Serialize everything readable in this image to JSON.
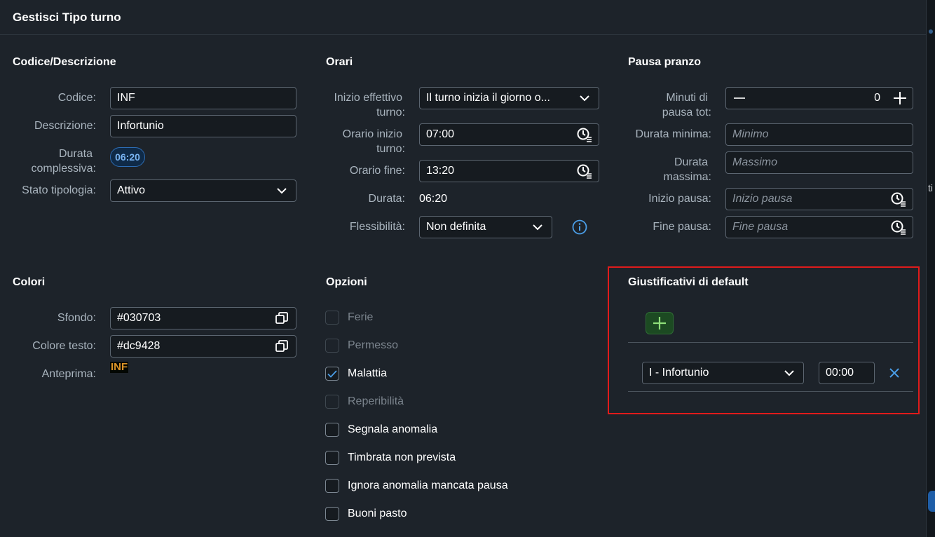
{
  "dialog": {
    "title": "Gestisci Tipo turno"
  },
  "sections": {
    "codice": {
      "title": "Codice/Descrizione",
      "codice_label": "Codice:",
      "codice_value": "INF",
      "descrizione_label": "Descrizione:",
      "descrizione_value": "Infortunio",
      "durata_label_1": "Durata",
      "durata_label_2": "complessiva:",
      "durata_value": "06:20",
      "stato_label": "Stato tipologia:",
      "stato_value": "Attivo"
    },
    "orari": {
      "title": "Orari",
      "inizio_effettivo_label_1": "Inizio effettivo",
      "inizio_effettivo_label_2": "turno:",
      "inizio_effettivo_value": "Il turno inizia il giorno o...",
      "orario_inizio_label_1": "Orario inizio",
      "orario_inizio_label_2": "turno:",
      "orario_inizio_value": "07:00",
      "orario_fine_label": "Orario fine:",
      "orario_fine_value": "13:20",
      "durata_label": "Durata:",
      "durata_value": "06:20",
      "flessibilita_label": "Flessibilità:",
      "flessibilita_value": "Non definita"
    },
    "pausa": {
      "title": "Pausa pranzo",
      "minuti_label_1": "Minuti di",
      "minuti_label_2": "pausa tot:",
      "minuti_value": "0",
      "durata_minima_label": "Durata minima:",
      "durata_minima_placeholder": "Minimo",
      "durata_massima_label_1": "Durata",
      "durata_massima_label_2": "massima:",
      "durata_massima_placeholder": "Massimo",
      "inizio_pausa_label": "Inizio pausa:",
      "inizio_pausa_placeholder": "Inizio pausa",
      "fine_pausa_label": "Fine pausa:",
      "fine_pausa_placeholder": "Fine pausa"
    },
    "colori": {
      "title": "Colori",
      "sfondo_label": "Sfondo:",
      "sfondo_value": "#030703",
      "testo_label": "Colore testo:",
      "testo_value": "#dc9428",
      "anteprima_label": "Anteprima:",
      "anteprima_text": "INF"
    },
    "opzioni": {
      "title": "Opzioni",
      "items": [
        {
          "label": "Ferie",
          "checked": false,
          "disabled": true
        },
        {
          "label": "Permesso",
          "checked": false,
          "disabled": true
        },
        {
          "label": "Malattia",
          "checked": true,
          "disabled": false
        },
        {
          "label": "Reperibilità",
          "checked": false,
          "disabled": true
        },
        {
          "label": "Segnala anomalia",
          "checked": false,
          "disabled": false
        },
        {
          "label": "Timbrata non prevista",
          "checked": false,
          "disabled": false
        },
        {
          "label": "Ignora anomalia mancata pausa",
          "checked": false,
          "disabled": false
        },
        {
          "label": "Buoni pasto",
          "checked": false,
          "disabled": false
        }
      ]
    },
    "giustificativi": {
      "title": "Giustificativi di default",
      "row_select": "I - Infortunio",
      "row_time": "00:00"
    }
  },
  "colors": {
    "accent": "#4a90d9",
    "highlight": "#e01b1b",
    "add_button": "#8fe07a",
    "preview_bg": "#030703",
    "preview_fg": "#dc9428"
  },
  "edge": {
    "fragment": "ti"
  }
}
